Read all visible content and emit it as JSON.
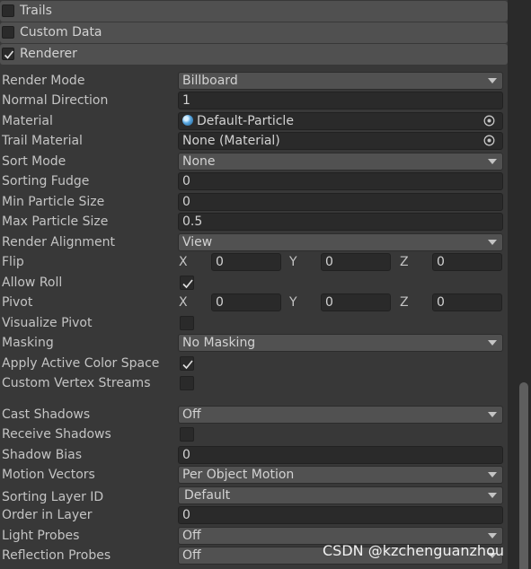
{
  "modules": [
    {
      "label": "Trails",
      "checked": false
    },
    {
      "label": "Custom Data",
      "checked": false
    },
    {
      "label": "Renderer",
      "checked": true
    }
  ],
  "renderer": {
    "render_mode": {
      "label": "Render Mode",
      "value": "Billboard"
    },
    "normal_direction": {
      "label": "Normal Direction",
      "value": "1"
    },
    "material": {
      "label": "Material",
      "value": "Default-Particle"
    },
    "trail_material": {
      "label": "Trail Material",
      "value": "None (Material)"
    },
    "sort_mode": {
      "label": "Sort Mode",
      "value": "None"
    },
    "sorting_fudge": {
      "label": "Sorting Fudge",
      "value": "0"
    },
    "min_particle_size": {
      "label": "Min Particle Size",
      "value": "0"
    },
    "max_particle_size": {
      "label": "Max Particle Size",
      "value": "0.5"
    },
    "render_alignment": {
      "label": "Render Alignment",
      "value": "View"
    },
    "flip": {
      "label": "Flip",
      "x_label": "X",
      "x": "0",
      "y_label": "Y",
      "y": "0",
      "z_label": "Z",
      "z": "0"
    },
    "allow_roll": {
      "label": "Allow Roll",
      "checked": true
    },
    "pivot": {
      "label": "Pivot",
      "x_label": "X",
      "x": "0",
      "y_label": "Y",
      "y": "0",
      "z_label": "Z",
      "z": "0"
    },
    "visualize_pivot": {
      "label": "Visualize Pivot",
      "checked": false
    },
    "masking": {
      "label": "Masking",
      "value": "No Masking"
    },
    "apply_active_color_space": {
      "label": "Apply Active Color Space",
      "checked": true
    },
    "custom_vertex_streams": {
      "label": "Custom Vertex Streams",
      "checked": false
    },
    "cast_shadows": {
      "label": "Cast Shadows",
      "value": "Off"
    },
    "receive_shadows": {
      "label": "Receive Shadows",
      "checked": false
    },
    "shadow_bias": {
      "label": "Shadow Bias",
      "value": "0"
    },
    "motion_vectors": {
      "label": "Motion Vectors",
      "value": "Per Object Motion"
    },
    "sorting_layer_id": {
      "label": "Sorting Layer ID",
      "value": "Default"
    },
    "order_in_layer": {
      "label": "Order in Layer",
      "value": "0"
    },
    "light_probes": {
      "label": "Light Probes",
      "value": "Off"
    },
    "reflection_probes": {
      "label": "Reflection Probes",
      "value": "Off"
    }
  },
  "watermark": "CSDN @kzchenguanzhou"
}
